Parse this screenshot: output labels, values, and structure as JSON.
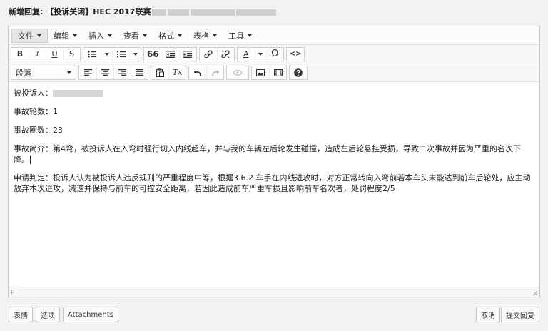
{
  "header": {
    "title": "新增回复: 【投诉关闭】HEC 2017联赛"
  },
  "menubar": {
    "items": [
      "文件",
      "编辑",
      "插入",
      "查看",
      "格式",
      "表格",
      "工具"
    ]
  },
  "toolbar": {
    "bold": "B",
    "italic": "I",
    "underline": "U",
    "strike": "S",
    "quote": "66",
    "text_color": "A",
    "omega": "Ω",
    "code": "<>",
    "clear_format": "Tx"
  },
  "format_select": {
    "value": "段落"
  },
  "content": {
    "complainee_label": "被投诉人：",
    "laps_label": "事故轮数：",
    "laps_value": "1",
    "rounds_label": "事故圈数：",
    "rounds_value": "23",
    "summary": "事故简介：第4弯，被投诉人在入弯时强行切入内线超车，并与我的车辆左后轮发生碰撞，造成左后轮悬挂受损，导致二次事故并因为严重的名次下降。",
    "judgement": "申请判定：投诉人认为被投诉人违反规则的严重程度中等，根据3.6.2 车手在内线进攻时，对方正常转向入弯前若本车头未能达到前车后轮处，应主动放弃本次进攻，减速并保持与前车的可控安全距离，若因此造成前车严重车损且影响前车名次者，处罚程度2/5"
  },
  "statusbar": {
    "path": "p"
  },
  "footer": {
    "emoji": "表情",
    "options": "选项",
    "attachments": "Attachments",
    "cancel": "取消",
    "submit": "提交回复"
  }
}
